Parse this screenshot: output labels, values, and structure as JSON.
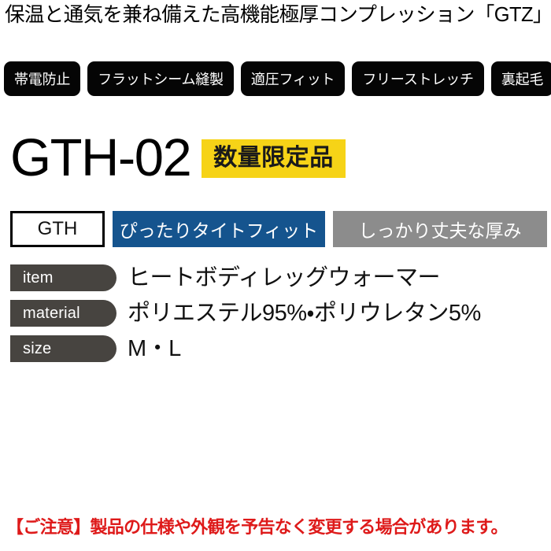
{
  "header": {
    "headline": "保温と通気を兼ね備えた高機能極厚コンプレッション「GTZ」"
  },
  "features": {
    "badges": [
      {
        "label": "帯電防止"
      },
      {
        "label": "フラットシーム縫製"
      },
      {
        "label": "適圧フィット"
      },
      {
        "label": "フリーストレッチ"
      },
      {
        "label": "裏起毛"
      }
    ]
  },
  "product": {
    "code": "GTH-02",
    "limited_label": "数量限定品"
  },
  "chips": [
    {
      "label": "GTH",
      "style": "outline"
    },
    {
      "label": "ぴったりタイトフィット",
      "style": "blue"
    },
    {
      "label": "しっかり丈夫な厚み",
      "style": "gray"
    }
  ],
  "specs": [
    {
      "label": "item",
      "value": "ヒートボディレッグウォーマー"
    },
    {
      "label": "material",
      "value": "ポリエステル95%・ポリウレタン5%"
    },
    {
      "label": "size",
      "value": "M・L"
    }
  ],
  "footer": {
    "notice": "【ご注意】製品の仕様や外観を予告なく変更する場合があります。"
  },
  "colors": {
    "badge_bg": "#050505",
    "limited_bg": "#f6d317",
    "chip_blue": "#15548e",
    "chip_gray": "#8c8c8c",
    "spec_label_bg": "#474440",
    "notice_red": "#de1a1a"
  }
}
